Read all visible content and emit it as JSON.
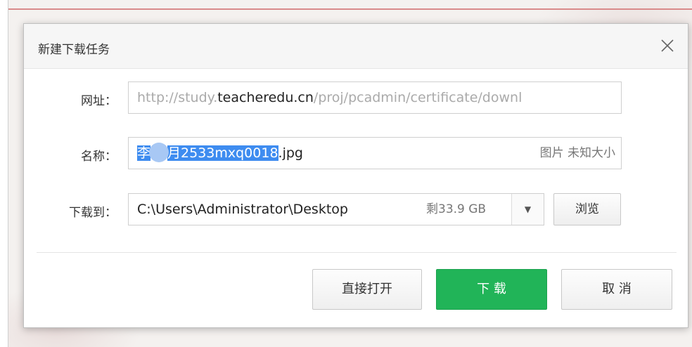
{
  "dialog": {
    "title": "新建下载任务",
    "close_icon": "close-icon"
  },
  "url_row": {
    "label": "网址：",
    "value_prefix": "http://study.",
    "value_domain": "teacheredu.cn",
    "value_rest": "/proj/pcadmin/certificate/downl"
  },
  "name_row": {
    "label": "名称：",
    "selected_start": "李",
    "selected_end": "月2533mxq0018",
    "extension": ".jpg",
    "file_type": "图片",
    "file_size": "未知大小"
  },
  "save_row": {
    "label": "下载到：",
    "path": "C:\\Users\\Administrator\\Desktop",
    "free_space": "剩33.9 GB",
    "dropdown_icon": "chevron-down-icon",
    "browse_label": "浏览"
  },
  "buttons": {
    "open_label": "直接打开",
    "download_label": "下 载",
    "cancel_label": "取 消"
  },
  "colors": {
    "accent_green": "#21b458",
    "selection_blue": "#3e8cf0"
  }
}
